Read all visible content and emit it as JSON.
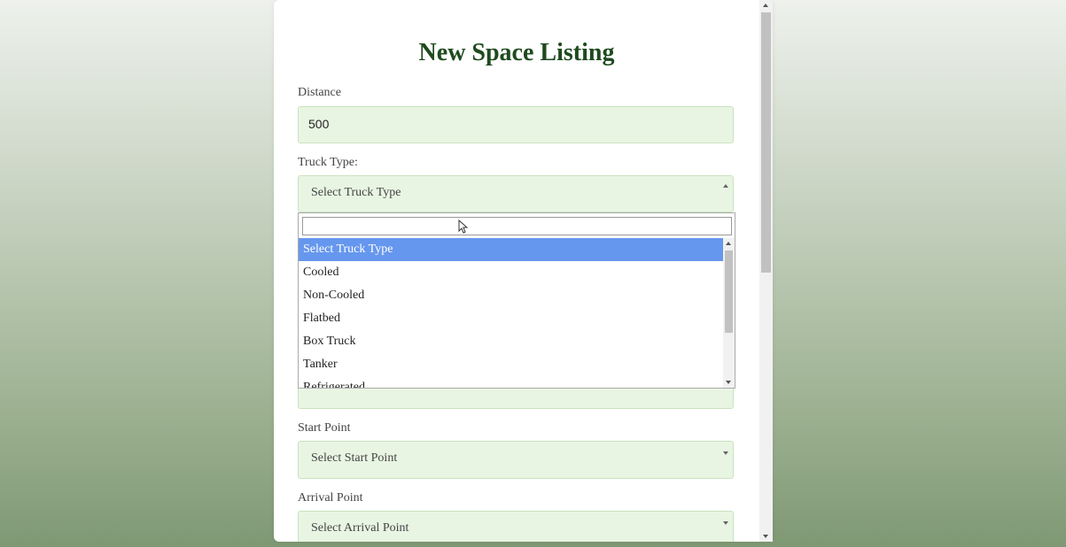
{
  "form": {
    "title": "New Space Listing",
    "distance": {
      "label": "Distance",
      "value": "500"
    },
    "truck_type": {
      "label": "Truck Type:",
      "selected": "Select Truck Type",
      "search_value": "",
      "options": [
        "Select Truck Type",
        "Cooled",
        "Non-Cooled",
        "Flatbed",
        "Box Truck",
        "Tanker",
        "Refrigerated"
      ],
      "highlighted_option": "Select Truck Type"
    },
    "start_point": {
      "label": "Start Point",
      "selected": "Select Start Point"
    },
    "arrival_point": {
      "label": "Arrival Point",
      "selected": "Select Arrival Point"
    }
  },
  "colors": {
    "title": "#1f4a1f",
    "input_background": "#e8f5e2",
    "highlight": "#6697ee"
  },
  "icons": {
    "caret_up": "caret-up-icon",
    "caret_down": "caret-down-icon",
    "cursor": "mouse-pointer-icon"
  }
}
